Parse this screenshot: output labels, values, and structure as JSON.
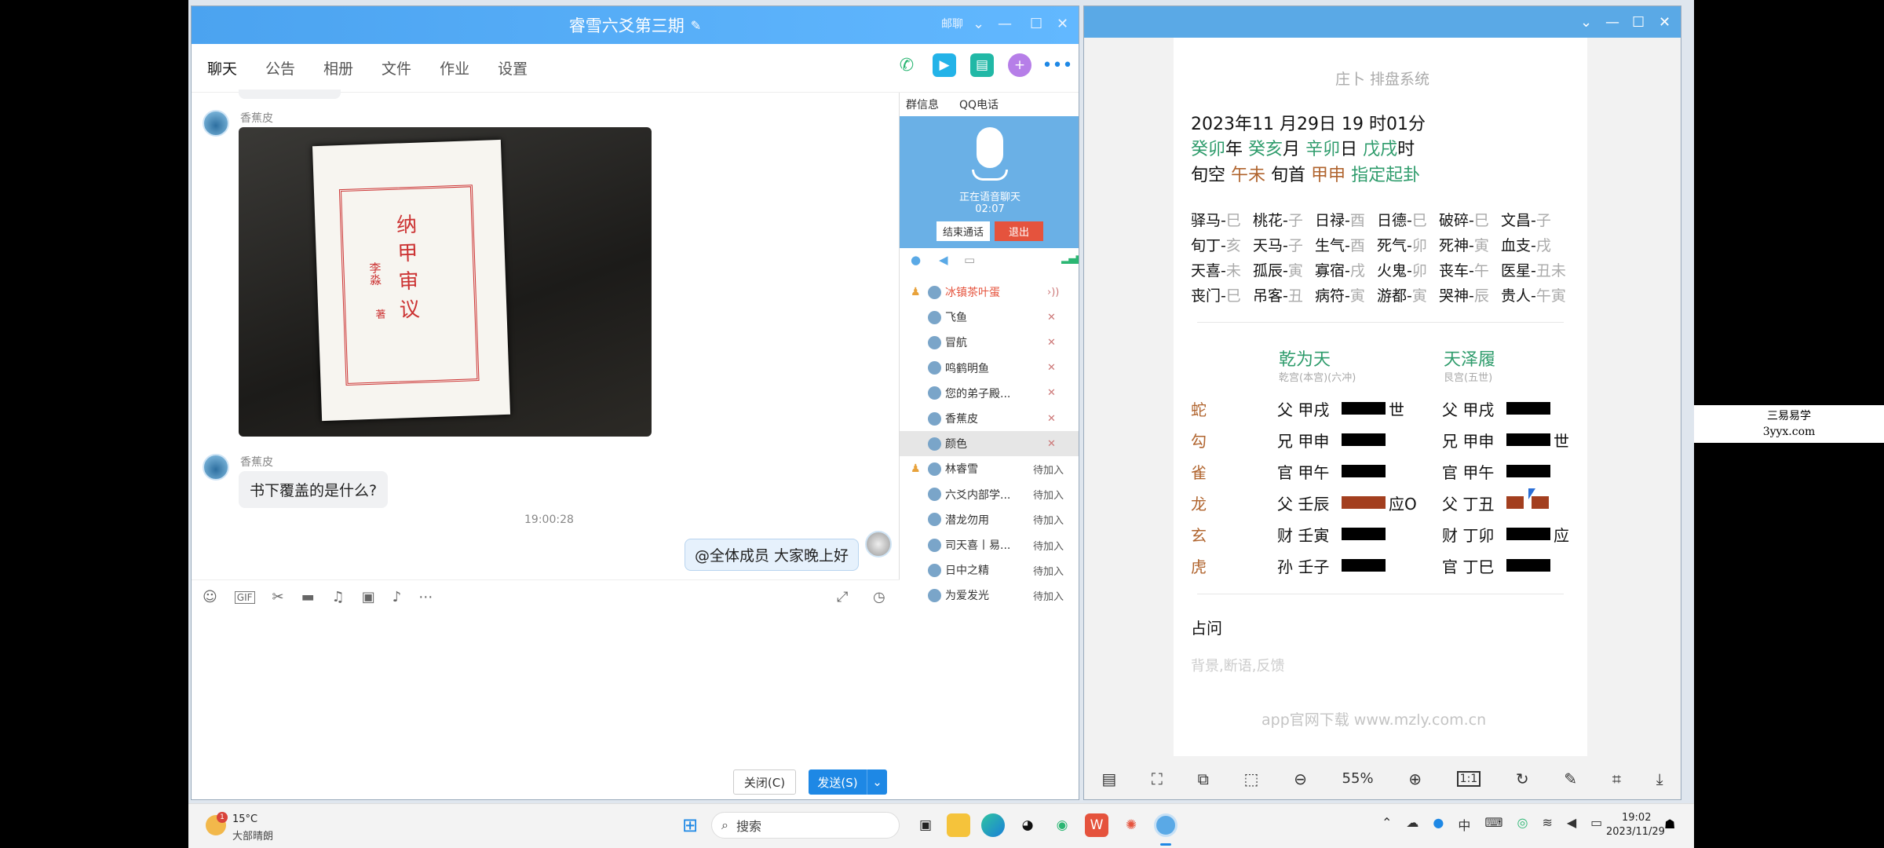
{
  "qq": {
    "title": "睿雪六爻第三期",
    "title_hint": "邮聊",
    "tabs": [
      "聊天",
      "公告",
      "相册",
      "文件",
      "作业",
      "设置"
    ],
    "messages": {
      "sender1": "香蕉皮",
      "sender2": "香蕉皮",
      "text2": "书下覆盖的是什么?",
      "time": "19:00:28",
      "mine": "@全体成员 大家晚上好"
    },
    "photo_text": {
      "title": "纳甲审议",
      "author": "李淼",
      "suffix": "著"
    },
    "buttons": {
      "close": "关闭(C)",
      "send": "发送(S)"
    },
    "side": {
      "tab1": "群信息",
      "tab2": "QQ电话",
      "voice_status": "正在语音聊天",
      "voice_time": "02:07",
      "end_call": "结束通话",
      "exit": "退出"
    },
    "members": [
      {
        "name": "冰镇茶叶蛋",
        "status": ""
      },
      {
        "name": "飞鱼",
        "status": ""
      },
      {
        "name": "冒航",
        "status": ""
      },
      {
        "name": "鸣鹤明鱼",
        "status": ""
      },
      {
        "name": "您的弟子殿...",
        "status": ""
      },
      {
        "name": "香蕉皮",
        "status": ""
      },
      {
        "name": "颜色",
        "status": ""
      },
      {
        "name": "林睿雪",
        "status": "待加入"
      },
      {
        "name": "六爻内部学...",
        "status": "待加入"
      },
      {
        "name": "潜龙勿用",
        "status": "待加入"
      },
      {
        "name": "司天喜丨易...",
        "status": "待加入"
      },
      {
        "name": "日中之精",
        "status": "待加入"
      },
      {
        "name": "为爱发光",
        "status": "待加入"
      }
    ]
  },
  "div": {
    "header": "庄卜 排盘系统",
    "date": "2023年11 月29日 19 时01分",
    "gz": {
      "y": "癸卯",
      "yu": "年",
      "m": "癸亥",
      "mu": "月",
      "d": "辛卯",
      "du": "日",
      "h": "戊戌",
      "hu": "时"
    },
    "xk": {
      "label": "旬空",
      "val": "午未",
      "label2": "旬首",
      "val2": "甲申",
      "tail": "指定起卦"
    },
    "shensha": [
      [
        "驿马-",
        "巳",
        "桃花-",
        "子",
        "日禄-",
        "酉",
        "日德-",
        "巳",
        "破碎-",
        "巳",
        "文昌-",
        "子"
      ],
      [
        "旬丁-",
        "亥",
        "天马-",
        "子",
        "生气-",
        "酉",
        "死气-",
        "卯",
        "死神-",
        "寅",
        "血支-",
        "戌"
      ],
      [
        "天喜-",
        "未",
        "孤辰-",
        "寅",
        "寡宿-",
        "戌",
        "火鬼-",
        "卯",
        "丧车-",
        "午",
        "医星-",
        "丑未"
      ],
      [
        "丧门-",
        "巳",
        "吊客-",
        "丑",
        "病符-",
        "寅",
        "游都-",
        "寅",
        "哭神-",
        "辰",
        "贵人-",
        "午寅"
      ]
    ],
    "gua1": {
      "name": "乾为天",
      "sub": "乾宫(本宫)(六冲)"
    },
    "gua2": {
      "name": "天泽履",
      "sub": "艮宫(五世)"
    },
    "liushen": [
      "蛇",
      "勾",
      "雀",
      "龙",
      "玄",
      "虎"
    ],
    "left": [
      "父 甲戌",
      "兄 甲申",
      "官 甲午",
      "父 壬辰",
      "财 壬寅",
      "孙 壬子"
    ],
    "left_mark": [
      "世",
      "",
      "",
      "应O",
      "",
      ""
    ],
    "right": [
      "父 甲戌",
      "兄 甲申",
      "官 甲午",
      "父 丁丑",
      "财 丁卯",
      "官 丁巳"
    ],
    "right_mark": [
      "",
      "世",
      "",
      "",
      "应",
      ""
    ],
    "question": "占问",
    "placeholder": "背景,断语,反馈",
    "footer": "app官网下载 www.mzly.com.cn",
    "zoom": "55%"
  },
  "taskbar": {
    "temp": "15°C",
    "weather": "大部晴朗",
    "search": "搜索",
    "time": "19:02",
    "date": "2023/11/29"
  },
  "watermark": {
    "l1": "三易易学",
    "l2": "3yyx.com"
  }
}
